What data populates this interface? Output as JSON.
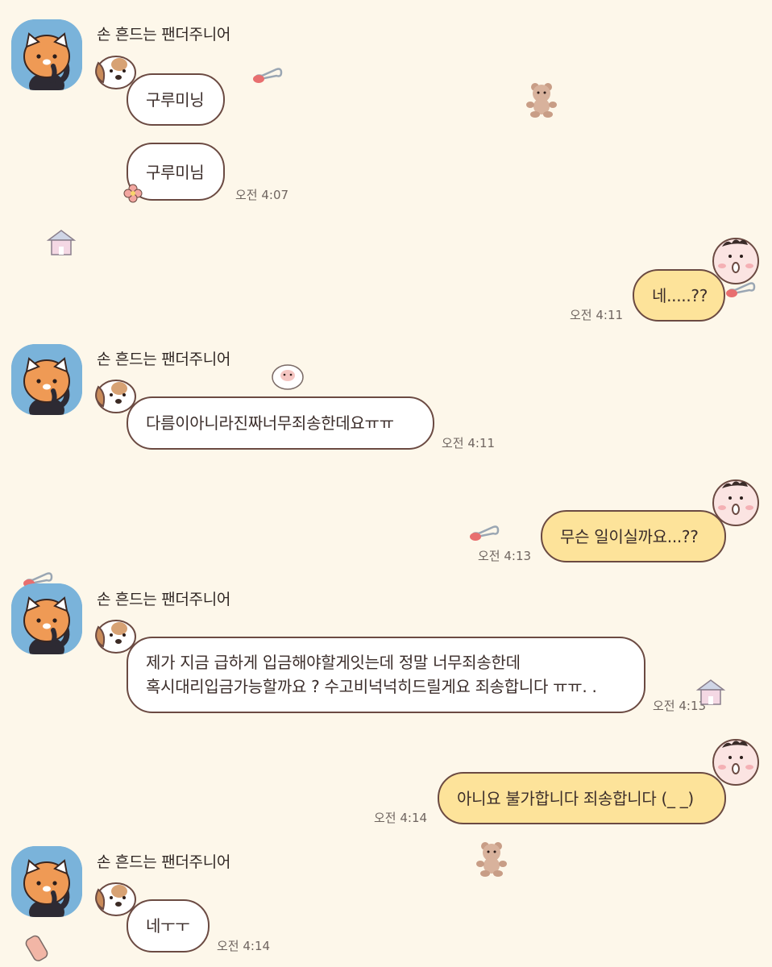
{
  "chat": {
    "sender_name": "손 흔드는 팬더주니어",
    "messages": [
      {
        "text": "구루미닝"
      },
      {
        "text": "구루미님",
        "time": "오전 4:07"
      },
      {
        "text": "네.....??",
        "time": "오전 4:11"
      },
      {
        "text": "다름이아니라진짜너무죄송한데요ㅠㅠ",
        "time": "오전 4:11"
      },
      {
        "text": "무슨 일이실까요...??",
        "time": "오전 4:13"
      },
      {
        "line1": "제가 지금 급하게 입금해야할게잇는데 정말 너무죄송한데",
        "line2": "혹시대리입금가능할까요 ? 수고비넉넉히드릴게요 죄송합니다 ㅠㅠ. .",
        "time": "오전 4:13"
      },
      {
        "text": "아니요 불가합니다 죄송합니다 (_ _)",
        "time": "오전 4:14"
      },
      {
        "text": "네ㅜㅜ",
        "time": "오전 4:14"
      }
    ]
  }
}
